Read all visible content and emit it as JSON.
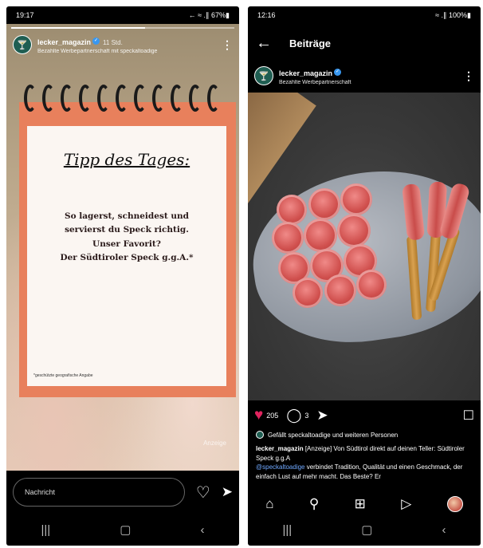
{
  "left": {
    "status": {
      "time": "19:17",
      "right": "← ≈ .∥ 67%▮"
    },
    "story": {
      "progress": 0.6,
      "account": "lecker_magazin",
      "time": "11 Std.",
      "subtitle": "Bezahlte Werbepartnerschaft mit speckaltoadige",
      "title": "Tipp des Tages:",
      "lines": [
        "So lagerst, schneidest und",
        "servierst du Speck richtig.",
        "Unser Favorit?",
        "Der Südtiroler Speck g.g.A.*"
      ],
      "footnote": "*geschützte geografische Angabe",
      "tag": "Anzeige"
    },
    "footer": {
      "placeholder": "Nachricht"
    },
    "nav": {
      "recents": "|||",
      "home": "▢",
      "back": "‹"
    }
  },
  "right": {
    "status": {
      "time": "12:16",
      "right": "≈ .∥ 100%▮"
    },
    "topbar": {
      "title": "Beiträge"
    },
    "post": {
      "account": "lecker_magazin",
      "subtitle": "Bezahlte Werbepartnerschaft",
      "likes": "205",
      "comments": "3",
      "liked_by": "Gefällt speckaltoadige und weiteren Personen",
      "caption_user": "lecker_magazin",
      "caption_text": "[Anzeige] Von Südtirol direkt auf deinen Teller: Südtiroler Speck g.g.A",
      "caption_mention": "@speckaltoadige",
      "caption_more": "verbindet Tradition, Qualität und einen Geschmack, der einfach Lust auf mehr macht. Das Beste? Er"
    },
    "nav": {
      "recents": "|||",
      "home": "▢",
      "back": "‹"
    }
  }
}
